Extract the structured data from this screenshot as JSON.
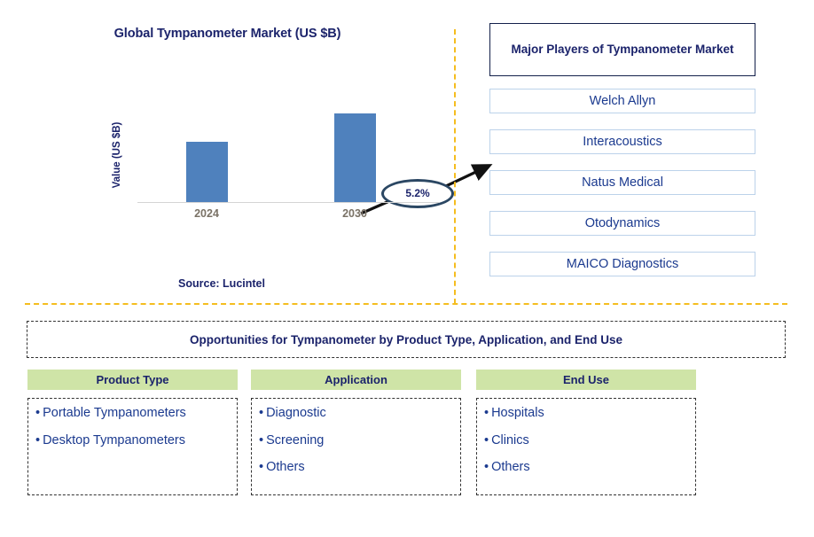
{
  "chart": {
    "title": "Global Tympanometer Market (US $B)",
    "y_axis_label": "Value (US $B)",
    "cagr_label": "5.2%",
    "source": "Source: Lucintel"
  },
  "chart_data": {
    "type": "bar",
    "title": "Global Tympanometer Market (US $B)",
    "categories": [
      "2024",
      "2030"
    ],
    "values": [
      0.68,
      1.0
    ],
    "xlabel": "",
    "ylabel": "Value (US $B)",
    "ylim": [
      0,
      1.33
    ],
    "grid": false,
    "legend": null,
    "annotations": [
      {
        "text": "5.2%",
        "type": "cagr-bubble-with-arrow",
        "between": [
          "2024",
          "2030"
        ]
      }
    ],
    "bar_color": "#4f81bd",
    "tick_label_color": "#7a7266",
    "source": "Source: Lucintel"
  },
  "players": {
    "header": "Major Players of Tympanometer Market",
    "items": [
      {
        "name": "Welch Allyn"
      },
      {
        "name": "Interacoustics"
      },
      {
        "name": "Natus Medical"
      },
      {
        "name": "Otodynamics"
      },
      {
        "name": "MAICO Diagnostics"
      }
    ]
  },
  "opportunities": {
    "banner": "Opportunities for Tympanometer by Product Type, Application, and End Use",
    "columns": [
      {
        "header": "Product Type",
        "items": [
          "Portable Tympanometers",
          "Desktop Tympanometers"
        ]
      },
      {
        "header": "Application",
        "items": [
          "Diagnostic",
          "Screening",
          "Others"
        ]
      },
      {
        "header": "End Use",
        "items": [
          "Hospitals",
          "Clinics",
          "Others"
        ]
      }
    ]
  },
  "colors": {
    "navy": "#1b236b",
    "link_blue": "#1b3a8f",
    "bar_blue": "#4f81bd",
    "accent_orange": "#f5bd1f",
    "header_green": "#cfe4a7",
    "bubble_outline": "#2b4763"
  }
}
